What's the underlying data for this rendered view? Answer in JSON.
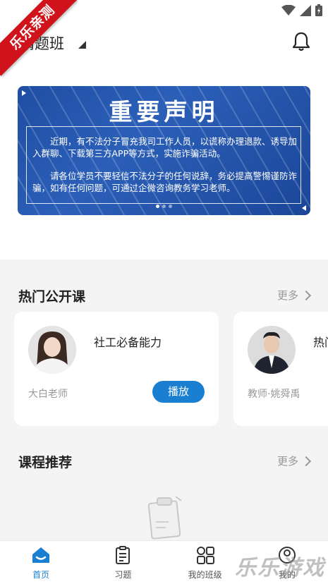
{
  "ribbon": {
    "text": "乐乐亲测"
  },
  "header": {
    "class_name": "精题班"
  },
  "banner": {
    "title": "重要声明",
    "para1": "近期，有不法分子冒充我司工作人员，以谎称办理退款、诱导加入群聊、下载第三方APP等方式，实施诈骗活动。",
    "para2": "请各位学员不要轻信不法分子的任何说辞，务必提高警惕谨防诈骗，如有任何问题，可通过企微咨询教务学习老师。",
    "dots": 3,
    "active_dot": 0
  },
  "hot": {
    "title": "热门公开课",
    "more": "更多",
    "cards": [
      {
        "course": "社工必备能力",
        "teacher": "大白老师",
        "button": "播放"
      },
      {
        "course": "热门",
        "teacher": "教师·姚舜禹"
      }
    ]
  },
  "recommend": {
    "title": "课程推荐",
    "more": "更多"
  },
  "tabs": [
    {
      "label": "首页",
      "icon": "home-icon",
      "active": true
    },
    {
      "label": "习题",
      "icon": "clipboard-icon",
      "active": false
    },
    {
      "label": "我的班级",
      "icon": "grid-icon",
      "active": false
    },
    {
      "label": "我的",
      "icon": "profile-icon",
      "active": false
    }
  ],
  "watermark": {
    "text": "乐乐游戏"
  },
  "colors": {
    "accent": "#1a7fd1",
    "banner": "#1f4ea3",
    "ribbon": "#d0131a"
  }
}
